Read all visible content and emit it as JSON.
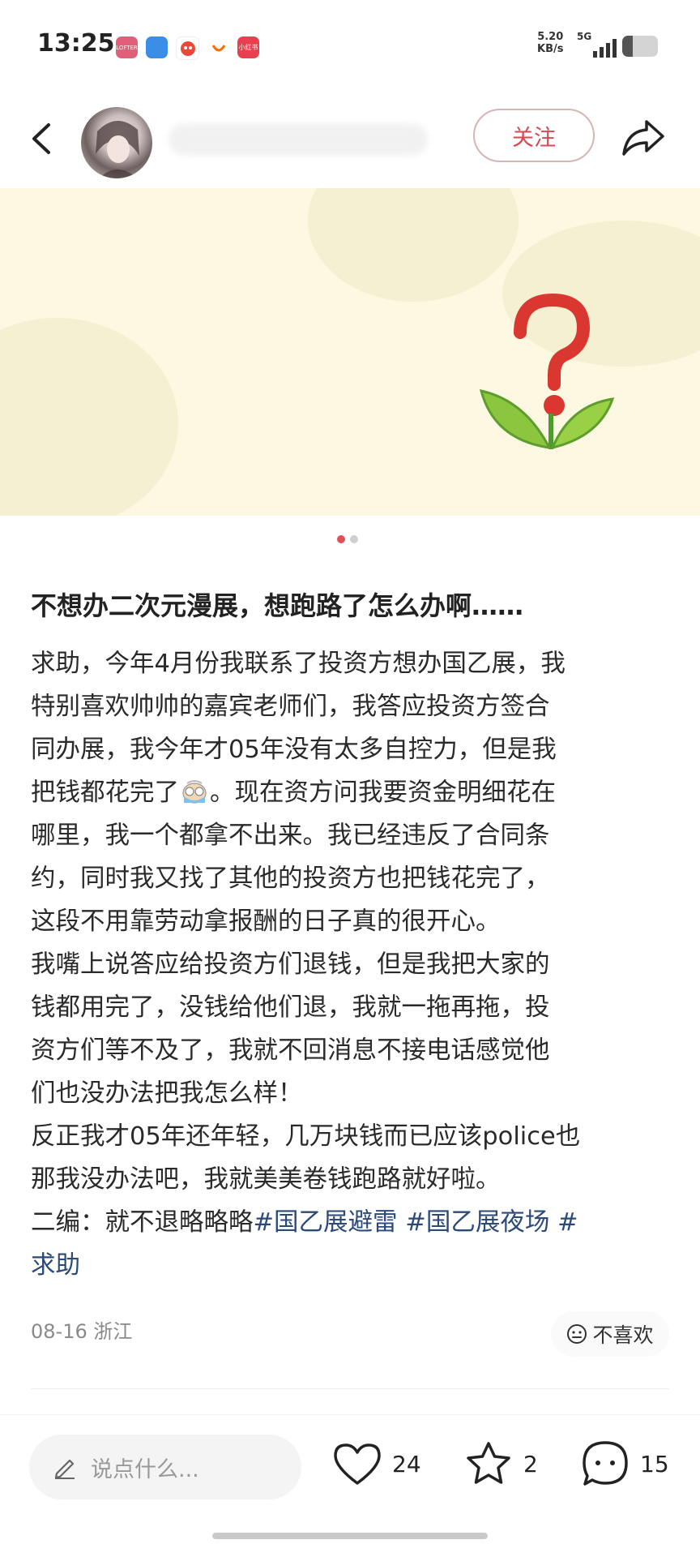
{
  "status_bar": {
    "time": "13:25",
    "app_icons": [
      {
        "name": "lofter-icon",
        "label": "LOFTER",
        "color": "#e0607a"
      },
      {
        "name": "chat-app-icon",
        "label": "",
        "color": "#3a8ee6"
      },
      {
        "name": "mascot-app-icon",
        "label": "",
        "color": "#e84a3a"
      },
      {
        "name": "taobao-icon",
        "label": "",
        "color": "#ff6a00"
      },
      {
        "name": "xiaohongshu-icon",
        "label": "小红书",
        "color": "#e8404f"
      }
    ],
    "net_speed_value": "5.20",
    "net_speed_unit": "KB/s",
    "network_type": "5G"
  },
  "header": {
    "follow_label": "关注"
  },
  "carousel": {
    "pages": 2,
    "active_index": 0
  },
  "post": {
    "title": "不想办二次元漫展，想跑路了怎么办啊……",
    "lines": [
      "求助，今年4月份我联系了投资方想办国乙展，我",
      "特别喜欢帅帅的嘉宾老师们，我答应投资方签合",
      "同办展，我今年才05年没有太多自控力，但是我",
      "把钱都花完了",
      "。现在资方问我要资金明细花在",
      "哪里，我一个都拿不出来。我已经违反了合同条",
      "约，同时我又找了其他的投资方也把钱花完了，",
      "这段不用靠劳动拿报酬的日子真的很开心。",
      "我嘴上说答应给投资方们退钱，但是我把大家的",
      "钱都用完了，没钱给他们退，我就一拖再拖，投",
      "资方们等不及了，我就不回消息不接电话感觉他",
      "们也没办法把我怎么样！",
      "反正我才05年还年轻，几万块钱而已应该police也",
      "那我没办法吧，我就美美卷钱跑路就好啦。",
      "二编：就不退略略略",
      "#国乙展避雷",
      "#国乙展夜场",
      "#",
      "求助"
    ],
    "date": "08-16",
    "location": "浙江",
    "dislike_label": "不喜欢"
  },
  "bottom_bar": {
    "comment_placeholder": "说点什么...",
    "likes": "24",
    "favorites": "2",
    "comments": "15"
  }
}
